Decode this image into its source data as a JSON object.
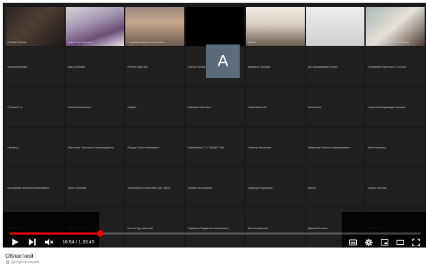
{
  "player": {
    "active_speaker_initial": "A",
    "current_time": "16:54",
    "duration": "1:33:45",
    "progress_fraction": 0.22,
    "accent_color": "#ff0000"
  },
  "tiles": [
    {
      "name": "Любовь Рыхоа",
      "style": "v1"
    },
    {
      "name": "Ирина Барамыгина",
      "style": "v2"
    },
    {
      "name": "Голубева Марина Сергеевна",
      "style": "v3"
    },
    {
      "name": "",
      "style": "v4"
    },
    {
      "name": "Ирина",
      "style": "v5"
    },
    {
      "name": "DFD",
      "style": "v6"
    },
    {
      "name": "Елена Владимировна Арбанова",
      "style": "v8"
    },
    {
      "name": "Кузьмина Вера",
      "style": ""
    },
    {
      "name": "Вика Кобзева",
      "style": ""
    },
    {
      "name": "iPhone (Виктор)",
      "style": ""
    },
    {
      "name": "Елена Прохорова",
      "style": ""
    },
    {
      "name": "Варвара Попкова",
      "style": ""
    },
    {
      "name": "АО Ахмыванова Елена",
      "style": ""
    },
    {
      "name": "Konstantin Kasenkova 2 school",
      "style": ""
    },
    {
      "name": "Русова Е.Н.",
      "style": ""
    },
    {
      "name": "Оксана Фоманина",
      "style": ""
    },
    {
      "name": "Мария",
      "style": ""
    },
    {
      "name": "Кукьева Светлана",
      "style": ""
    },
    {
      "name": "Соболева А.Ю.",
      "style": ""
    },
    {
      "name": "Анастасия",
      "style": ""
    },
    {
      "name": "Карпова Владимира Наталья",
      "style": ""
    },
    {
      "name": "Наталья",
      "style": ""
    },
    {
      "name": "Морозова Светлана Александровна",
      "style": ""
    },
    {
      "name": "Бирдук Олеся Ивановна",
      "style": ""
    },
    {
      "name": "Щербакова С.Н. МАДОУ №1",
      "style": ""
    },
    {
      "name": "Татьяна Морозова",
      "style": ""
    },
    {
      "name": "Федотова Галина Владимировна",
      "style": ""
    },
    {
      "name": "Инна Уварова",
      "style": ""
    },
    {
      "name": "Мокеурова Наталья Васильевна",
      "style": ""
    },
    {
      "name": "Ольга Чулкова",
      "style": ""
    },
    {
      "name": "Анастасия Копина МБУ ДО \"ДОБ\"",
      "style": ""
    },
    {
      "name": "Оксана Астафьева",
      "style": ""
    },
    {
      "name": "Надежда Горшкова",
      "style": ""
    },
    {
      "name": "алина",
      "style": ""
    },
    {
      "name": "Щукин Леонид",
      "style": ""
    },
    {
      "name": "Окунева З.Н.",
      "style": ""
    },
    {
      "name": "Андреев Дарья",
      "style": ""
    },
    {
      "name": "Елена Турчанинова",
      "style": ""
    },
    {
      "name": "Редькина Людмила Николаевна",
      "style": ""
    },
    {
      "name": "Катя Богданова",
      "style": ""
    },
    {
      "name": "Марина Титрак",
      "style": ""
    },
    {
      "name": "Екатерина",
      "style": ""
    }
  ],
  "video": {
    "title": "Областной",
    "visibility": "Доступ по ссылке"
  }
}
